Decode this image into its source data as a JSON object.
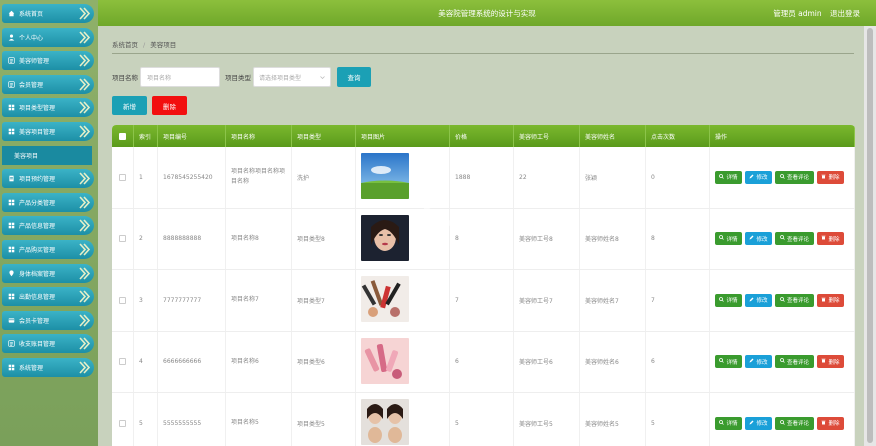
{
  "sidebar": {
    "items": [
      {
        "label": "系统首页",
        "icon": "home-icon"
      },
      {
        "label": "个人中心",
        "icon": "user-icon"
      },
      {
        "label": "美容师管理",
        "icon": "list-icon"
      },
      {
        "label": "会员管理",
        "icon": "list-icon"
      },
      {
        "label": "项目类型管理",
        "icon": "grid-icon"
      },
      {
        "label": "美容项目管理",
        "icon": "grid-icon"
      },
      {
        "label": "项目预约管理",
        "icon": "doc-icon"
      },
      {
        "label": "产品分类管理",
        "icon": "grid-icon"
      },
      {
        "label": "产品信息管理",
        "icon": "grid-icon"
      },
      {
        "label": "产品购买管理",
        "icon": "grid-icon"
      },
      {
        "label": "身体档案管理",
        "icon": "pin-icon"
      },
      {
        "label": "出勤信息管理",
        "icon": "grid-icon"
      },
      {
        "label": "会员卡管理",
        "icon": "card-icon"
      },
      {
        "label": "收支账目管理",
        "icon": "list-icon"
      },
      {
        "label": "系统管理",
        "icon": "grid-icon"
      }
    ],
    "sub_item": "美容项目"
  },
  "header": {
    "title": "美容院管理系统的设计与实现",
    "user_label": "管理员 admin",
    "logout": "退出登录"
  },
  "breadcrumb": {
    "home": "系统首页",
    "sep": "/",
    "current": "美容项目"
  },
  "search": {
    "name_label": "项目名称",
    "name_placeholder": "项目名称",
    "type_label": "项目类型",
    "type_placeholder": "请选择项目类型",
    "query_button": "查询"
  },
  "actions": {
    "add": "新增",
    "delete": "删除"
  },
  "table": {
    "headers": [
      "索引",
      "项目编号",
      "项目名称",
      "项目类型",
      "项目图片",
      "价格",
      "美容师工号",
      "美容师姓名",
      "点击次数",
      "操作"
    ],
    "rows": [
      {
        "index": "1",
        "code": "1678545255420",
        "name": "项目名称项目名称项目名称",
        "type": "洗护",
        "price": "1888",
        "staff_no": "22",
        "staff_name": "张颖",
        "clicks": "0"
      },
      {
        "index": "2",
        "code": "8888888888",
        "name": "项目名称8",
        "type": "项目类型8",
        "price": "8",
        "staff_no": "美容师工号8",
        "staff_name": "美容师姓名8",
        "clicks": "8"
      },
      {
        "index": "3",
        "code": "7777777777",
        "name": "项目名称7",
        "type": "项目类型7",
        "price": "7",
        "staff_no": "美容师工号7",
        "staff_name": "美容师姓名7",
        "clicks": "7"
      },
      {
        "index": "4",
        "code": "6666666666",
        "name": "项目名称6",
        "type": "项目类型6",
        "price": "6",
        "staff_no": "美容师工号6",
        "staff_name": "美容师姓名6",
        "clicks": "6"
      },
      {
        "index": "5",
        "code": "5555555555",
        "name": "项目名称5",
        "type": "项目类型5",
        "price": "5",
        "staff_no": "美容师工号5",
        "staff_name": "美容师姓名5",
        "clicks": "5"
      }
    ],
    "op_labels": {
      "detail": "详情",
      "edit": "修改",
      "review": "查看评论",
      "delete": "删除"
    }
  },
  "colors": {
    "header_green": "#6fa82a",
    "sidebar_teal": "#1d8fa6",
    "danger": "#f20f0f",
    "primary": "#1ba0b5"
  }
}
